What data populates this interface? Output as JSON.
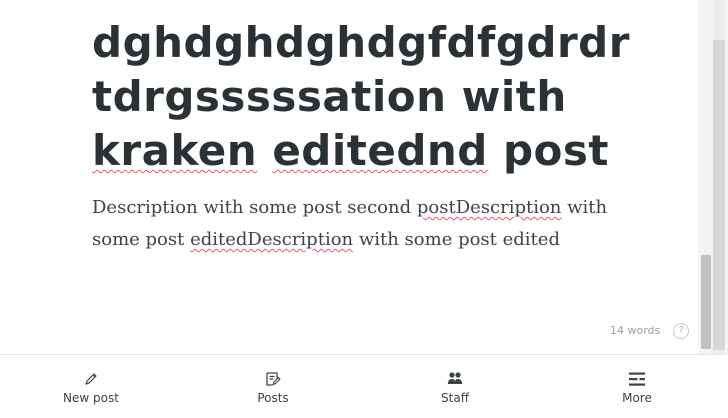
{
  "post": {
    "title_line_1": "dghdghdghdgfdfgdrdr",
    "title_line_2": "tdrgsssssation with",
    "title_line_3_word_1": "kraken",
    "title_line_3_word_2": "editednd",
    "title_line_3_word_3": "post",
    "description_part_1": "Description with some post second ",
    "description_part_2": "postDescription",
    "description_part_3": " with some post ",
    "description_part_4": "editedDescription",
    "description_part_5": " with some post edited"
  },
  "editor": {
    "word_count": "14 words",
    "help_glyph": "?"
  },
  "tabbar": {
    "tabs": [
      {
        "label": "New post",
        "icon": "pencil-icon"
      },
      {
        "label": "Posts",
        "icon": "posts-icon"
      },
      {
        "label": "Staff",
        "icon": "staff-icon"
      },
      {
        "label": "More",
        "icon": "more-icon"
      }
    ]
  },
  "colors": {
    "text": "#2b3235",
    "spellcheck": "#e06060",
    "muted": "#9aa0a4"
  }
}
